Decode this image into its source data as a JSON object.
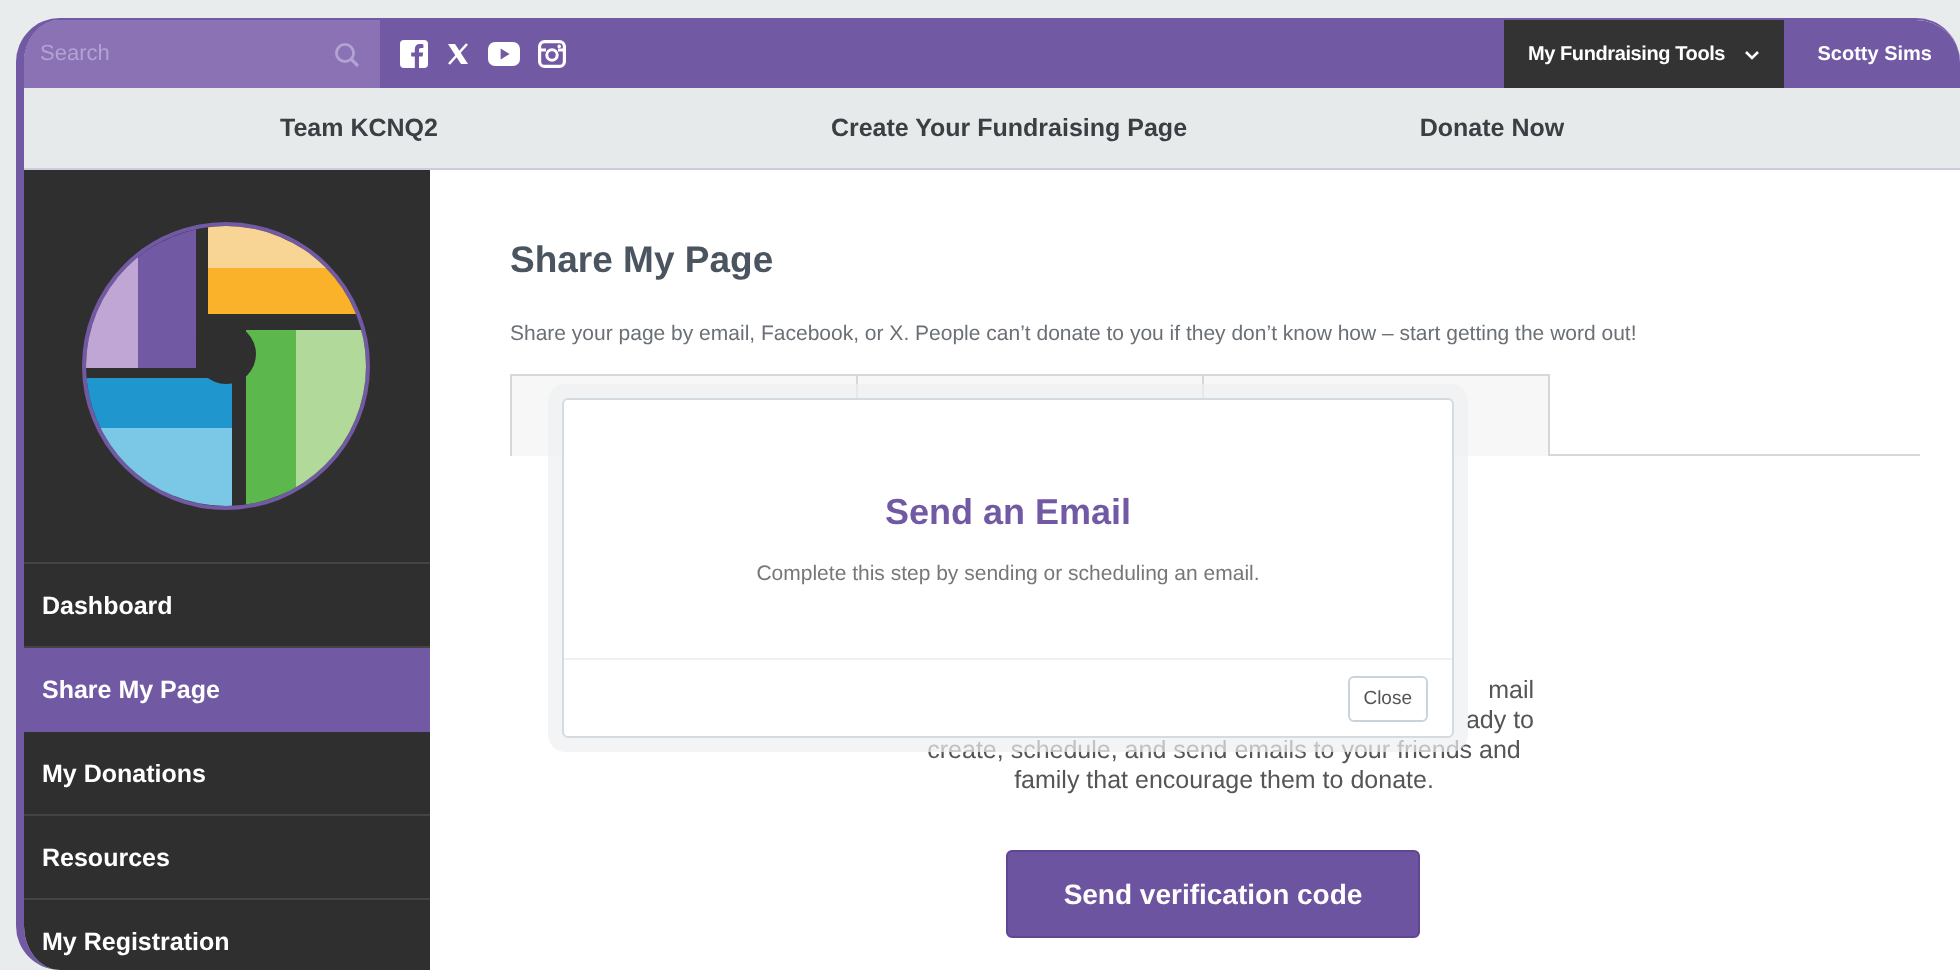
{
  "top_bar": {
    "search": {
      "placeholder": "Search"
    },
    "tools_menu": {
      "label": "My Fundraising Tools"
    },
    "user": "Scotty Sims"
  },
  "nav": [
    {
      "label": "Team KCNQ2"
    },
    {
      "label": "Create Your Fundraising Page"
    },
    {
      "label": "Donate Now"
    }
  ],
  "sidebar": {
    "items": [
      {
        "label": "Dashboard",
        "selected": false
      },
      {
        "label": "Share My Page",
        "selected": true
      },
      {
        "label": "My Donations",
        "selected": false
      },
      {
        "label": "Resources",
        "selected": false
      },
      {
        "label": "My Registration",
        "selected": false
      }
    ]
  },
  "main": {
    "title": "Share My Page",
    "description": "Share your page by email, Facebook, or X. People can’t donate to you if they don’t know how – start getting the word out!",
    "background_text": [
      {
        "kind": "cut",
        "text": "mail"
      },
      {
        "kind": "cut",
        "text": "ady to"
      },
      {
        "kind": "full",
        "text": "create, schedule, and send emails to your friends and"
      },
      {
        "kind": "full",
        "text": "family that encourage them to donate."
      }
    ],
    "button": "Send verification code"
  },
  "modal": {
    "title": "Send an Email",
    "message": "Complete this step by sending or scheduling an email.",
    "close_button": "Close"
  }
}
